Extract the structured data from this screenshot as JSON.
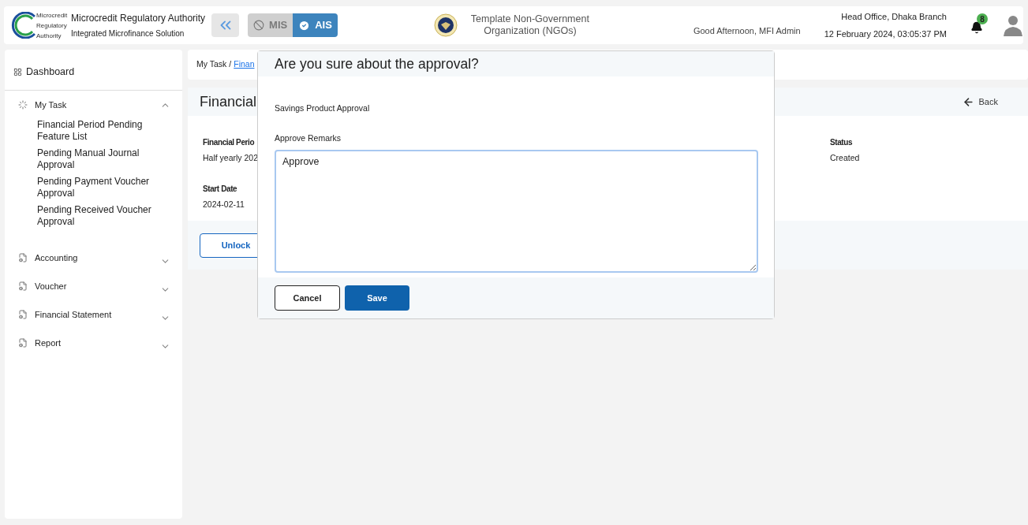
{
  "header": {
    "logo_text": [
      "Microcredit",
      "Regulatory",
      "Authority"
    ],
    "org_name": "Microcredit Regulatory Authority",
    "org_subtitle": "Integrated Microfinance Solution",
    "modules": [
      {
        "label": "MIS",
        "selected": false
      },
      {
        "label": "AIS",
        "selected": true
      }
    ],
    "ngo_name": "Template Non-Government Organization (NGOs)",
    "greeting": "Good Afternoon, MFI Admin",
    "branch": "Head Office, Dhaka Branch",
    "datetime": "12 February 2024, 03:05:37 PM",
    "notification_count": "8"
  },
  "sidebar": {
    "dashboard": "Dashboard",
    "items": [
      {
        "label": "My Task",
        "kind": "task",
        "expanded": true,
        "children": [
          "Financial Period Pending Feature List",
          "Pending Manual Journal Approval",
          "Pending Payment Voucher Approval",
          "Pending Received Voucher Approval"
        ]
      },
      {
        "label": "Accounting",
        "kind": "document",
        "expanded": false
      },
      {
        "label": "Voucher",
        "kind": "document",
        "expanded": false
      },
      {
        "label": "Financial Statement",
        "kind": "document",
        "expanded": false
      },
      {
        "label": "Report",
        "kind": "document",
        "expanded": false
      }
    ]
  },
  "breadcrumb": {
    "parent": "My Task",
    "separator": "/",
    "current": "Finan"
  },
  "page": {
    "title": "Financial",
    "back": "Back",
    "fields": [
      {
        "label": "Financial Perio",
        "value": "Half yearly 202"
      },
      {
        "label": "Status",
        "value": "Created"
      },
      {
        "label": "Start Date",
        "value": "2024-02-11"
      }
    ],
    "unlock": "Unlock"
  },
  "dialog": {
    "title": "Are you sure about the approval?",
    "subtitle": "Savings Product Approval",
    "remarks_label": "Approve Remarks",
    "remarks_value": "Approve",
    "cancel": "Cancel",
    "save": "Save"
  }
}
